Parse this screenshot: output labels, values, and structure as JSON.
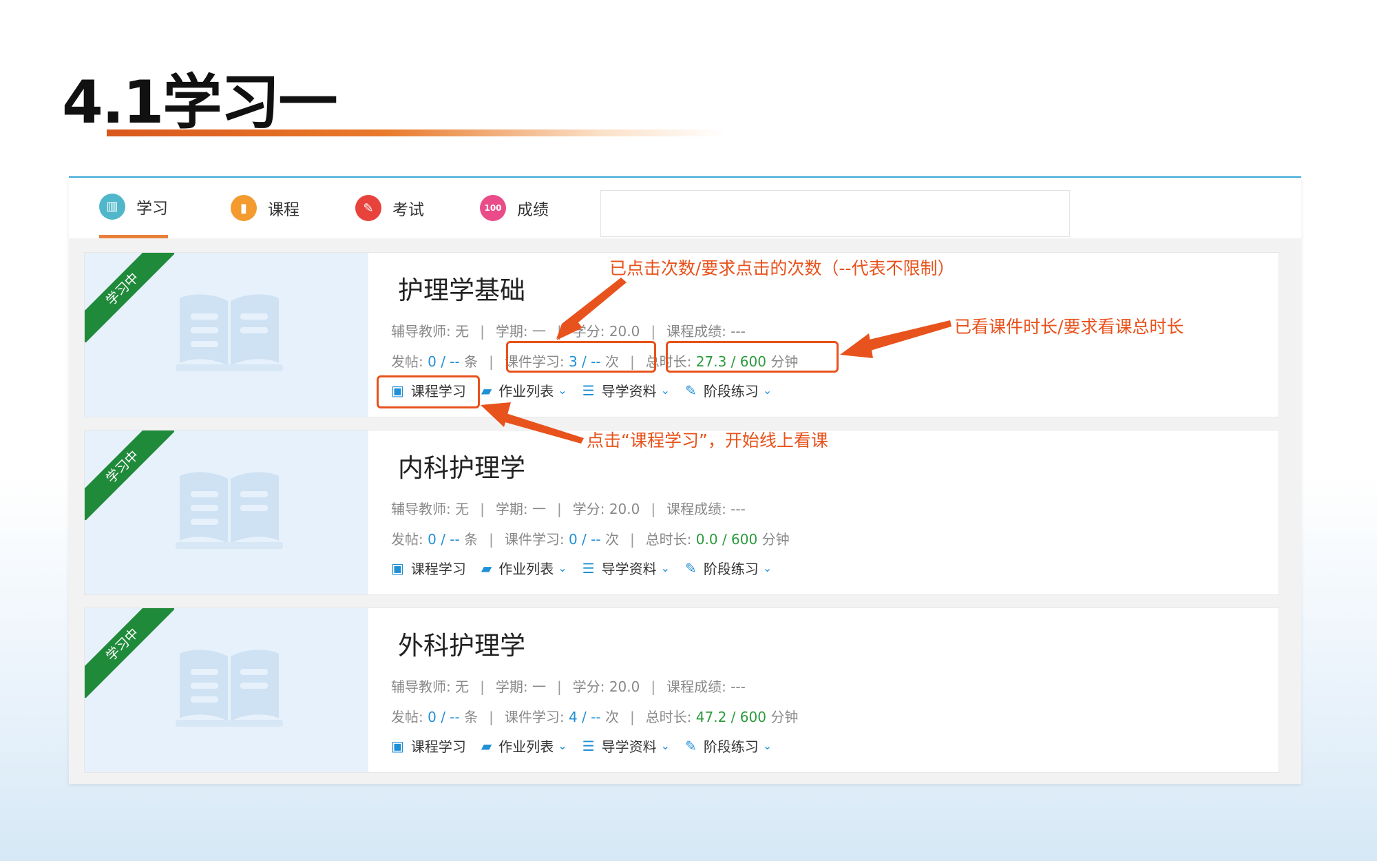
{
  "slide": {
    "title": "4.1学习一"
  },
  "tabs": [
    {
      "label": "学习",
      "color": "#4fb7c9",
      "active": true
    },
    {
      "label": "课程",
      "color": "#f39b2e",
      "active": false
    },
    {
      "label": "考试",
      "color": "#e8423c",
      "active": false
    },
    {
      "label": "成绩",
      "color": "#e94c89",
      "active": false
    }
  ],
  "labels": {
    "teacher": "辅导教师:",
    "term": "学期:",
    "credit": "学分:",
    "grade": "课程成绩:",
    "posts": "发帖:",
    "posts_unit": "条",
    "study": "课件学习:",
    "study_unit": "次",
    "duration": "总时长:",
    "duration_unit": "分钟"
  },
  "ribbon": "学习中",
  "actions": [
    {
      "label": "课程学习"
    },
    {
      "label": "作业列表"
    },
    {
      "label": "导学资料"
    },
    {
      "label": "阶段练习"
    }
  ],
  "courses": [
    {
      "name": "护理学基础",
      "teacher": "无",
      "term": "一",
      "credit": "20.0",
      "grade": "---",
      "posts": "0 / --",
      "study": "3 / --",
      "duration": "27.3 / 600"
    },
    {
      "name": "内科护理学",
      "teacher": "无",
      "term": "一",
      "credit": "20.0",
      "grade": "---",
      "posts": "0 / --",
      "study": "0 / --",
      "duration": "0.0 / 600"
    },
    {
      "name": "外科护理学",
      "teacher": "无",
      "term": "一",
      "credit": "20.0",
      "grade": "---",
      "posts": "0 / --",
      "study": "4 / --",
      "duration": "47.2 / 600"
    }
  ],
  "annotations": {
    "clicks": "已点击次数/要求点击的次数（--代表不限制）",
    "duration": "已看课件时长/要求看课总时长",
    "start": "点击“课程学习”，开始线上看课"
  },
  "colors": {
    "accent": "#e8521c",
    "link_blue": "#1f8fd6",
    "green": "#2b9a3c"
  }
}
